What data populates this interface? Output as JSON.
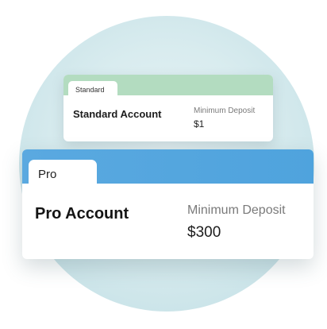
{
  "standard": {
    "tab_label": "Standard",
    "title": "Standard Account",
    "min_deposit_label": "Minimum Deposit",
    "min_deposit_value": "$1",
    "band_color": "#b3dcc0"
  },
  "pro": {
    "tab_label": "Pro",
    "title": "Pro Account",
    "min_deposit_label": "Minimum Deposit",
    "min_deposit_value": "$300",
    "band_color": "#4fa3dd"
  },
  "background": {
    "circle_color": "#d9ecef"
  }
}
